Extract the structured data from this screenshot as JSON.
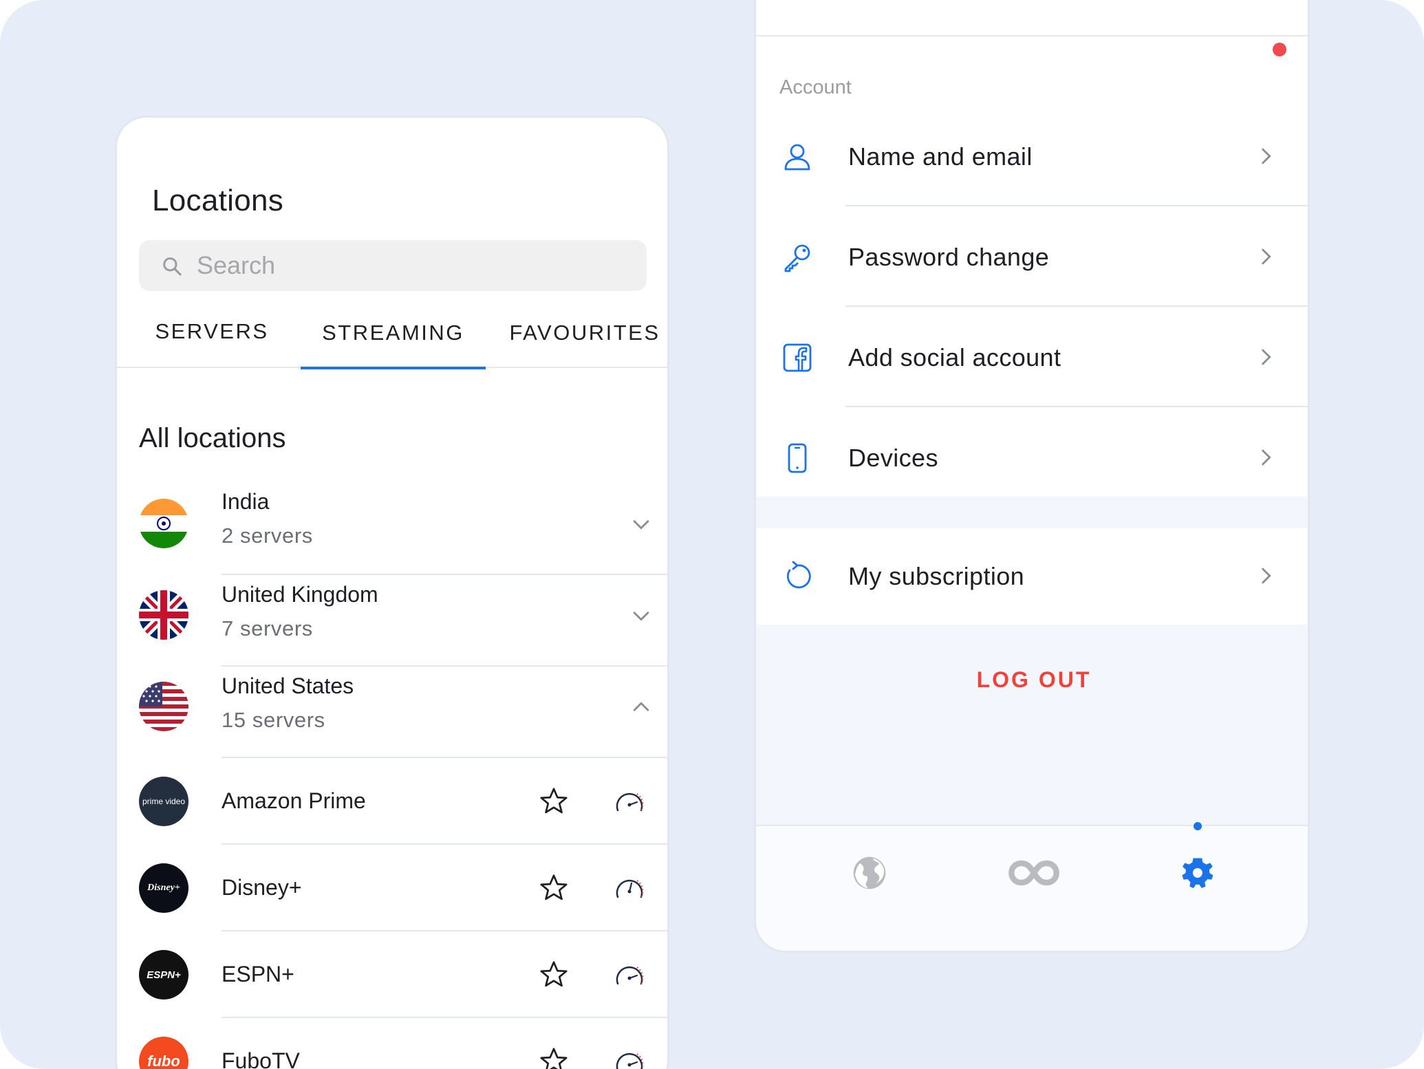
{
  "locations": {
    "title": "Locations",
    "search_placeholder": "Search",
    "tabs": [
      "SERVERS",
      "STREAMING",
      "FAVOURITES"
    ],
    "active_tab": "STREAMING",
    "section_title": "All locations",
    "countries": [
      {
        "name": "India",
        "servers": "2 servers",
        "expanded": false,
        "flag": "flag-india-icon"
      },
      {
        "name": "United Kingdom",
        "servers": "7 servers",
        "expanded": false,
        "flag": "flag-uk-icon"
      },
      {
        "name": "United States",
        "servers": "15 servers",
        "expanded": true,
        "flag": "flag-us-icon"
      }
    ],
    "services": [
      {
        "name": "Amazon Prime",
        "logo_text": "prime video",
        "logo_color": "#232f3e"
      },
      {
        "name": "Disney+",
        "logo_text": "Disney+",
        "logo_color": "#0b0e16"
      },
      {
        "name": "ESPN+",
        "logo_text": "ESPN+",
        "logo_color": "#111111"
      },
      {
        "name": "FuboTV",
        "logo_text": "fubo",
        "logo_color": "#f34a1f"
      }
    ]
  },
  "account": {
    "section_label": "Account",
    "items": [
      {
        "label": "Name and email",
        "icon": "user-icon",
        "notification": true
      },
      {
        "label": "Password change",
        "icon": "key-icon",
        "notification": false
      },
      {
        "label": "Add social account",
        "icon": "facebook-icon",
        "notification": false
      },
      {
        "label": "Devices",
        "icon": "phone-icon",
        "notification": false
      }
    ],
    "subscription_label": "My subscription",
    "logout_label": "LOG OUT"
  },
  "bottom_nav": {
    "items": [
      "globe-icon",
      "infinity-icon",
      "settings-icon"
    ],
    "active": "settings-icon"
  },
  "colors": {
    "accent": "#1a73e8",
    "logout": "#f0413a",
    "notification": "#f04a4e",
    "background": "#e6edf9"
  }
}
